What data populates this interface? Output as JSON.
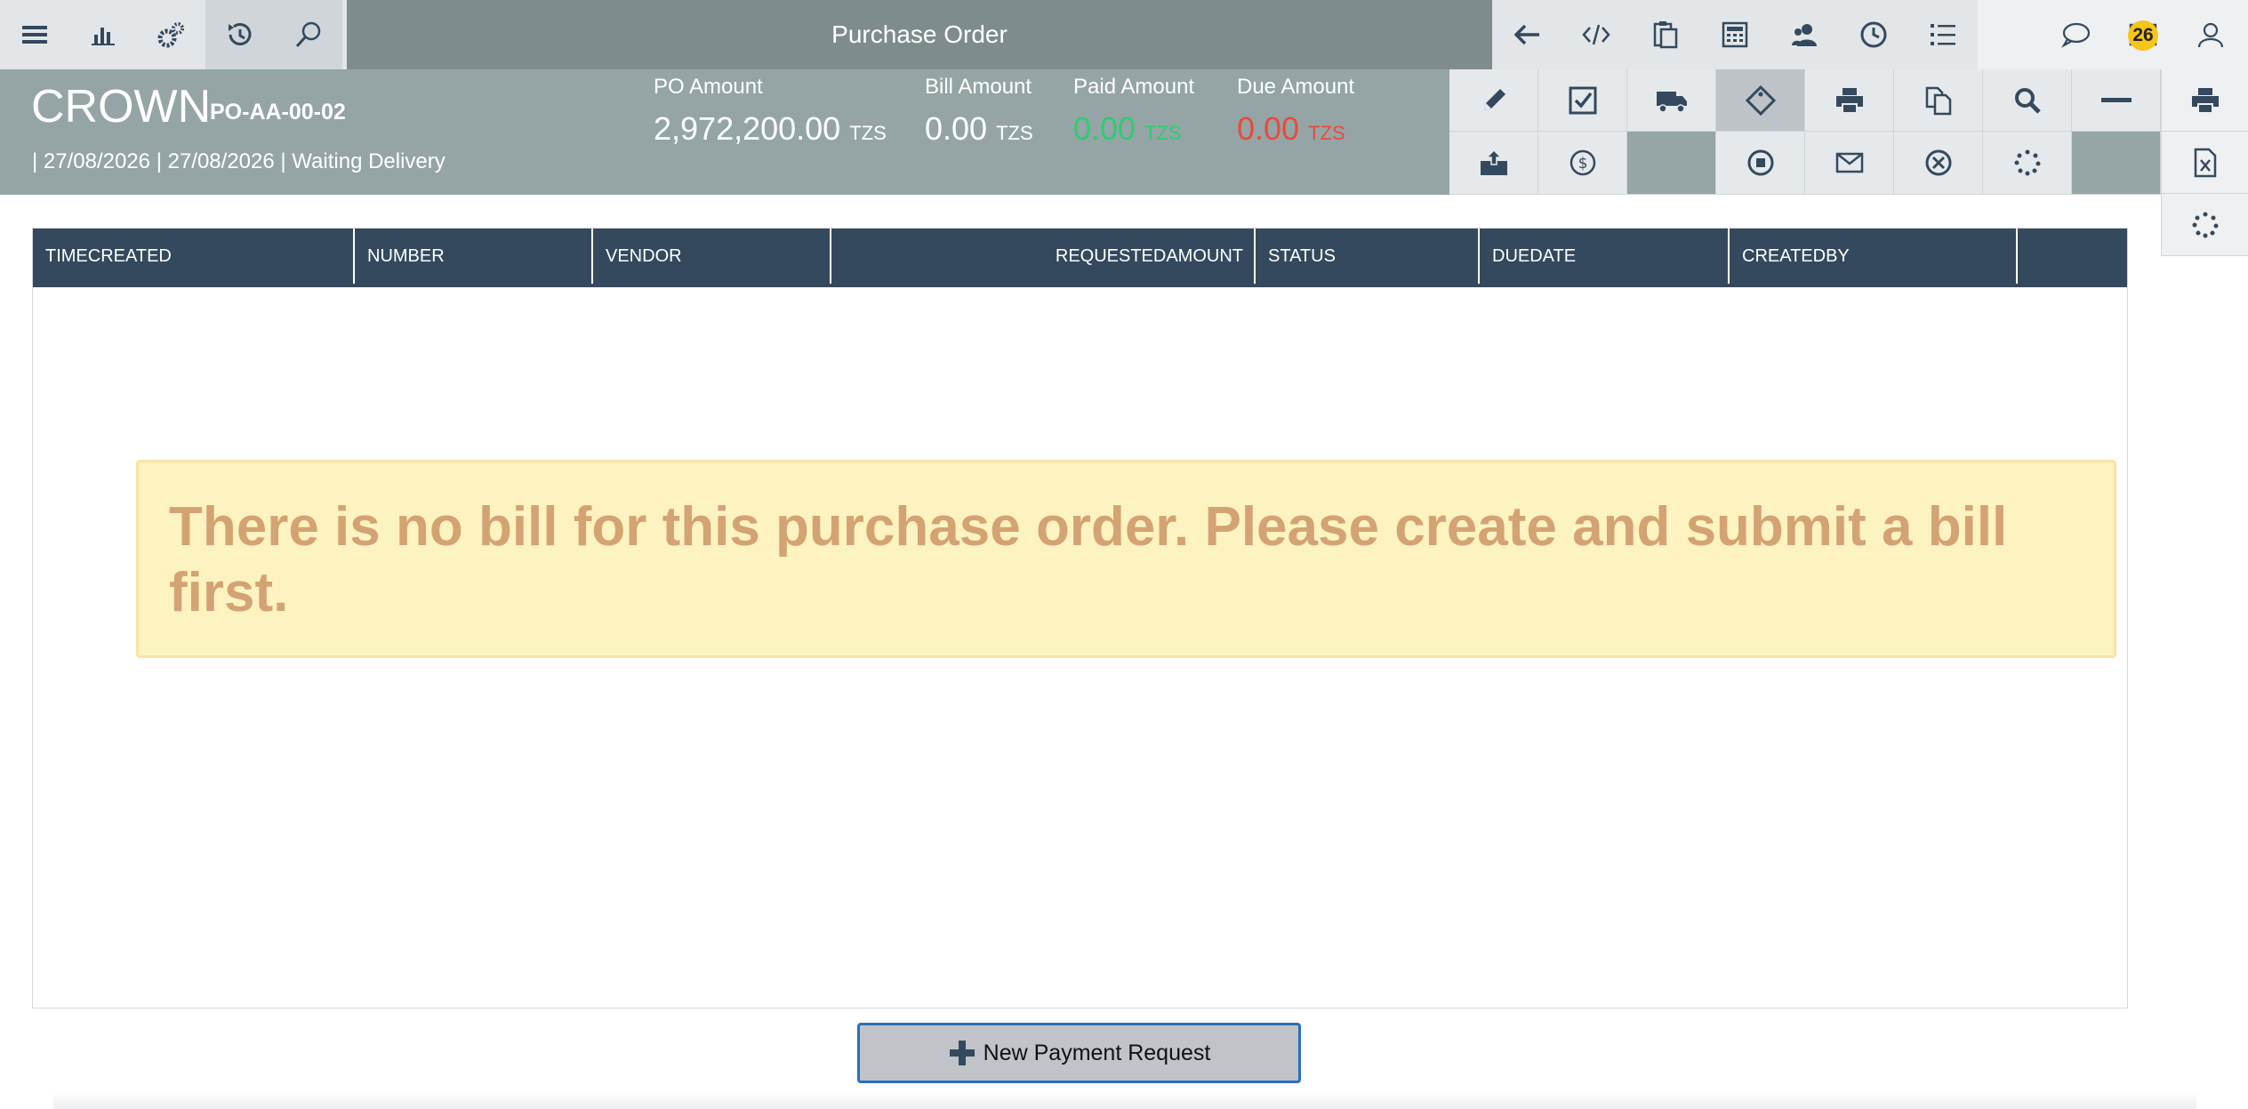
{
  "topbar": {
    "title": "Purchase Order",
    "left_icons": [
      "menu-icon",
      "chart-icon",
      "gears-icon",
      "history-icon",
      "search-icon"
    ],
    "right_icons": [
      "back-arrow-icon",
      "code-icon",
      "clipboard-icon",
      "calculator-icon",
      "users-icon",
      "clock-icon",
      "list-icon"
    ],
    "far_icons": [
      "chat-icon",
      "mail-icon",
      "user-icon"
    ],
    "notification_count": "26"
  },
  "header": {
    "company": "CROWN",
    "po_number": "PO-AA-00-02",
    "subline": "| 27/08/2026 | 27/08/2026 | Waiting Delivery",
    "amounts": [
      {
        "label": "PO Amount",
        "value": "2,972,200.00",
        "currency": "TZS"
      },
      {
        "label": "Bill Amount",
        "value": "0.00",
        "currency": "TZS"
      },
      {
        "label": "Paid Amount",
        "value": "0.00",
        "currency": "TZS"
      },
      {
        "label": "Due Amount",
        "value": "0.00",
        "currency": "TZS"
      }
    ]
  },
  "actions": {
    "row1": [
      "edit-icon",
      "check-icon",
      "truck-icon",
      "tag-icon",
      "print-icon",
      "copy-icon",
      "zoom-icon",
      "minus-icon"
    ],
    "row2": [
      "archive-icon",
      "dollar-icon",
      "",
      "stop-icon",
      "envelope-icon",
      "cancel-icon",
      "spinner-icon",
      ""
    ],
    "side": [
      "print-icon",
      "excel-icon",
      "spinner-icon"
    ]
  },
  "table": {
    "columns": [
      "TIMECREATED",
      "NUMBER",
      "VENDOR",
      "REQUESTEDAMOUNT",
      "STATUS",
      "DUEDATE",
      "CREATEDBY"
    ]
  },
  "notice": "There is no bill for this purchase order. Please create and submit a bill first.",
  "new_payment_button": "New Payment Request"
}
